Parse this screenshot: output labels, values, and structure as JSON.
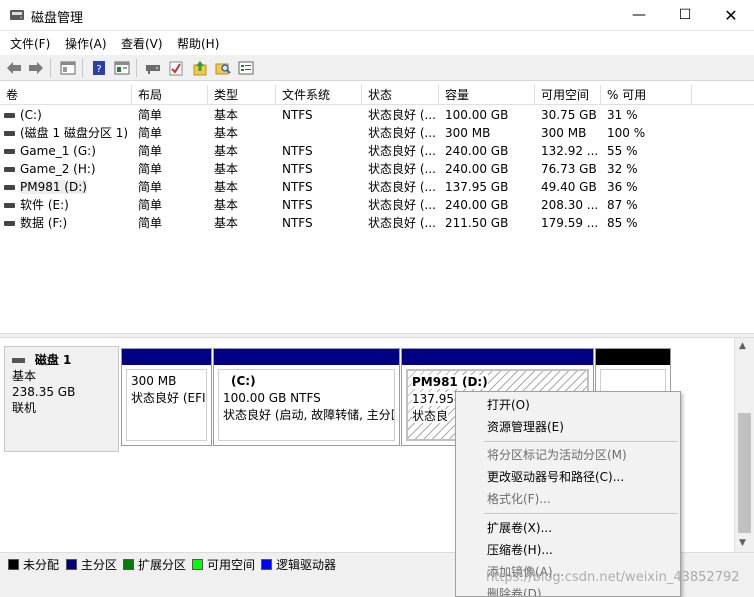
{
  "window": {
    "title": "磁盘管理",
    "minimize": "—",
    "maximize": "☐",
    "close": "✕"
  },
  "menu": [
    "文件(F)",
    "操作(A)",
    "查看(V)",
    "帮助(H)"
  ],
  "toolbar_icons": [
    "back-icon",
    "forward-icon",
    "console-tree-icon",
    "help-icon",
    "properties-icon",
    "connect-drive-icon",
    "check-icon",
    "upload-folder-icon",
    "search-folder-icon",
    "settings-icon"
  ],
  "table": {
    "columns": [
      "卷",
      "布局",
      "类型",
      "文件系统",
      "状态",
      "容量",
      "可用空间",
      "% 可用"
    ],
    "rows": [
      [
        "(C:)",
        "简单",
        "基本",
        "NTFS",
        "状态良好 (...",
        "100.00 GB",
        "30.75 GB",
        "31 %"
      ],
      [
        "(磁盘 1 磁盘分区 1)",
        "简单",
        "基本",
        "",
        "状态良好 (...",
        "300 MB",
        "300 MB",
        "100 %"
      ],
      [
        "Game_1 (G:)",
        "简单",
        "基本",
        "NTFS",
        "状态良好 (...",
        "240.00 GB",
        "132.92 ...",
        "55 %"
      ],
      [
        "Game_2 (H:)",
        "简单",
        "基本",
        "NTFS",
        "状态良好 (...",
        "240.00 GB",
        "76.73 GB",
        "32 %"
      ],
      [
        "PM981 (D:)",
        "简单",
        "基本",
        "NTFS",
        "状态良好 (...",
        "137.95 GB",
        "49.40 GB",
        "36 %"
      ],
      [
        "软件 (E:)",
        "简单",
        "基本",
        "NTFS",
        "状态良好 (...",
        "240.00 GB",
        "208.30 ...",
        "87 %"
      ],
      [
        "数据 (F:)",
        "简单",
        "基本",
        "NTFS",
        "状态良好 (...",
        "211.50 GB",
        "179.59 ...",
        "85 %"
      ]
    ],
    "selected_row": 4
  },
  "disk": {
    "name": "磁盘 1",
    "type": "基本",
    "size": "238.35 GB",
    "status": "联机",
    "partitions": [
      {
        "title": "",
        "size": "300 MB",
        "status": "状态良好 (EFI"
      },
      {
        "title": "(C:)",
        "size": "100.00 GB NTFS",
        "status": "状态良好 (启动, 故障转储, 主分区"
      },
      {
        "title": "PM981  (D:)",
        "size": "137.95",
        "status": "状态良"
      },
      {
        "title": "",
        "size": "",
        "status": ""
      }
    ]
  },
  "legend": [
    {
      "label": "未分配",
      "color": "#000000"
    },
    {
      "label": "主分区",
      "color": "#000082"
    },
    {
      "label": "扩展分区",
      "color": "#008000"
    },
    {
      "label": "可用空间",
      "color": "#00ff00"
    },
    {
      "label": "逻辑驱动器",
      "color": "#0000ff"
    }
  ],
  "context_menu": {
    "items": [
      {
        "label": "打开(O)",
        "enabled": true
      },
      {
        "label": "资源管理器(E)",
        "enabled": true
      },
      {
        "label": "将分区标记为活动分区(M)",
        "enabled": false
      },
      {
        "label": "更改驱动器号和路径(C)...",
        "enabled": true
      },
      {
        "label": "格式化(F)...",
        "enabled": false
      },
      {
        "label": "扩展卷(X)...",
        "enabled": true
      },
      {
        "label": "压缩卷(H)...",
        "enabled": true
      },
      {
        "label": "添加镜像(A)...",
        "enabled": false
      },
      {
        "label": "删除卷(D)...",
        "enabled": false
      }
    ]
  },
  "watermark": "https://blog.csdn.net/weixin_43852792"
}
